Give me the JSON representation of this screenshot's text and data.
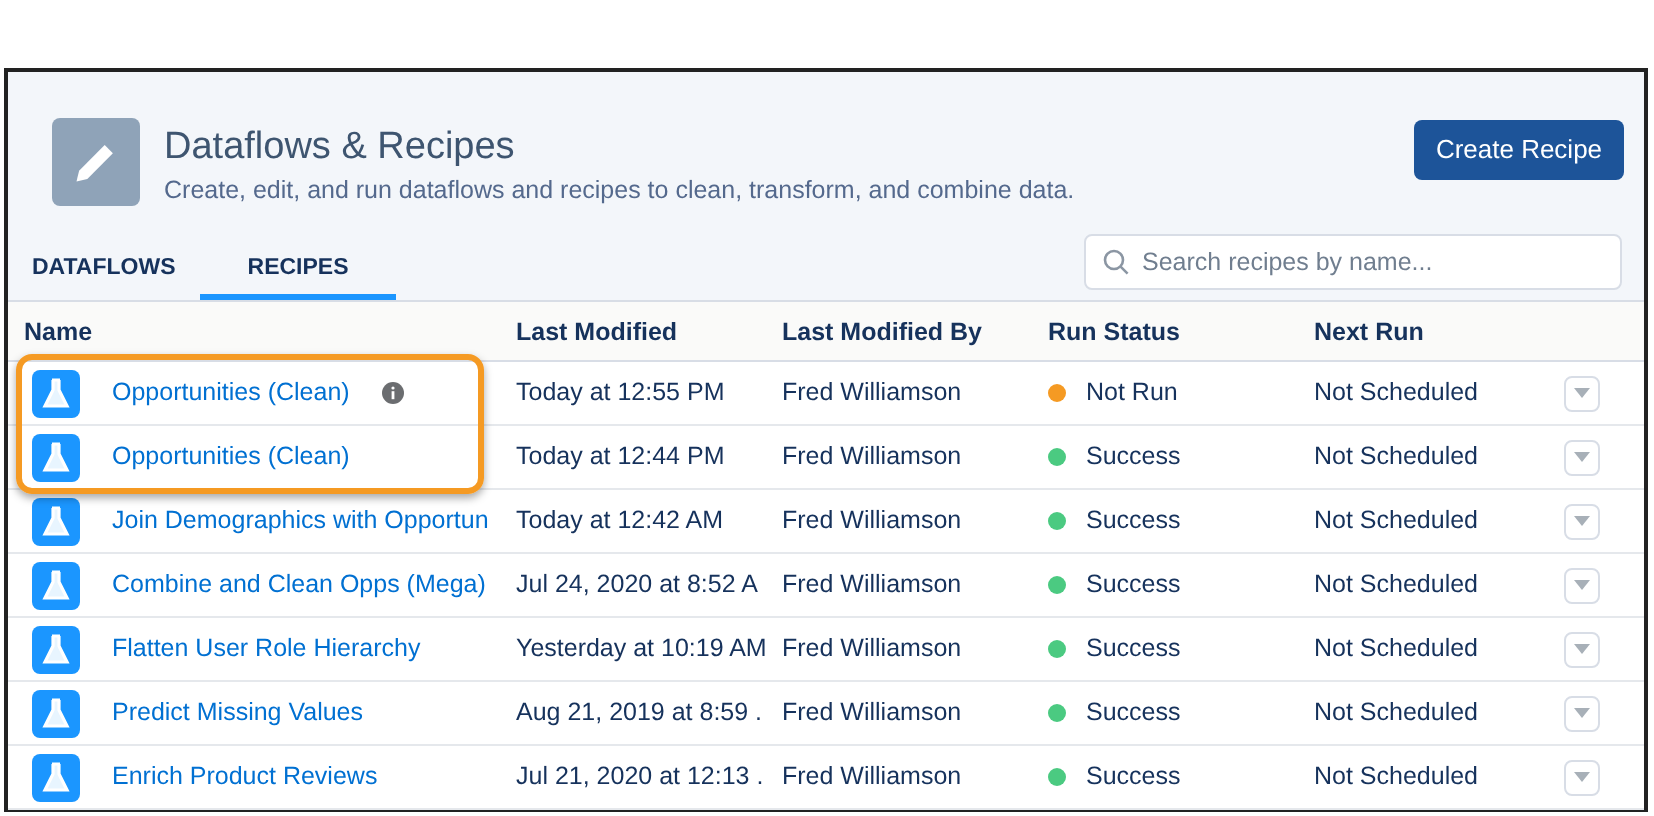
{
  "header": {
    "title": "Dataflows & Recipes",
    "subtitle": "Create, edit, and run dataflows and recipes to clean, transform, and combine data.",
    "button": "Create Recipe"
  },
  "tabs": [
    {
      "label": "DATAFLOWS",
      "selected": false
    },
    {
      "label": "RECIPES",
      "selected": true
    }
  ],
  "search": {
    "placeholder": "Search recipes by name..."
  },
  "table": {
    "columns": [
      "Name",
      "Last Modified",
      "Last Modified By",
      "Run Status",
      "Next Run"
    ],
    "rows": [
      {
        "name": "Opportunities (Clean)",
        "info_icon": true,
        "highlighted": true,
        "last_modified": "Today at 12:55 PM",
        "modified_by": "Fred Williamson",
        "status": "Not Run",
        "color": "#f59a23",
        "next_run": "Not Scheduled"
      },
      {
        "name": "Opportunities (Clean)",
        "info_icon": false,
        "highlighted": true,
        "last_modified": "Today at 12:44 PM",
        "modified_by": "Fred Williamson",
        "status": "Success",
        "color": "#4bca81",
        "next_run": "Not Scheduled"
      },
      {
        "name": "Join Demographics with Opportun",
        "info_icon": false,
        "highlighted": false,
        "last_modified": "Today at 12:42 AM",
        "modified_by": "Fred Williamson",
        "status": "Success",
        "color": "#4bca81",
        "next_run": "Not Scheduled"
      },
      {
        "name": "Combine and Clean Opps (Mega)",
        "info_icon": false,
        "highlighted": false,
        "last_modified": "Jul 24, 2020 at 8:52 A",
        "modified_by": "Fred Williamson",
        "status": "Success",
        "color": "#4bca81",
        "next_run": "Not Scheduled"
      },
      {
        "name": "Flatten User Role Hierarchy",
        "info_icon": false,
        "highlighted": false,
        "last_modified": "Yesterday at 10:19 AM",
        "modified_by": "Fred Williamson",
        "status": "Success",
        "color": "#4bca81",
        "next_run": "Not Scheduled"
      },
      {
        "name": "Predict Missing Values",
        "info_icon": false,
        "highlighted": false,
        "last_modified": "Aug 21, 2019 at 8:59 .",
        "modified_by": "Fred Williamson",
        "status": "Success",
        "color": "#4bca81",
        "next_run": "Not Scheduled"
      },
      {
        "name": "Enrich Product Reviews",
        "info_icon": false,
        "highlighted": false,
        "last_modified": "Jul 21, 2020 at 12:13 .",
        "modified_by": "Fred Williamson",
        "status": "Success",
        "color": "#4bca81",
        "next_run": "Not Scheduled"
      }
    ]
  }
}
